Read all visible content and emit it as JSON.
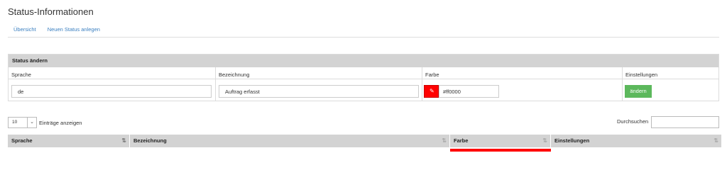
{
  "page": {
    "title": "Status-Informationen"
  },
  "subnav": {
    "items": [
      "Übersicht",
      "Neuen Status anlegen"
    ]
  },
  "edit_panel": {
    "title": "Status ändern",
    "columns": {
      "language": "Sprache",
      "designation": "Bezeichnung",
      "color": "Farbe",
      "settings": "Einstellungen"
    },
    "values": {
      "language": "de",
      "designation": "Auftrag erfasst",
      "color_hex": "#ff0000"
    },
    "save_label": "ändern",
    "swatch_icon": "pencil-icon"
  },
  "table_controls": {
    "page_length": "10",
    "page_length_label": "Einträge anzeigen",
    "search_label": "Durchsuchen",
    "search_value": ""
  },
  "table": {
    "headers": [
      "Sprache",
      "Bezeichnung",
      "Farbe",
      "Einstellungen"
    ],
    "first_row_color": "#ff0000"
  },
  "colors": {
    "link": "#3a7fc0",
    "header_bg": "#d3d3d3",
    "success": "#5cb85c",
    "status_color": "#ff0000"
  }
}
